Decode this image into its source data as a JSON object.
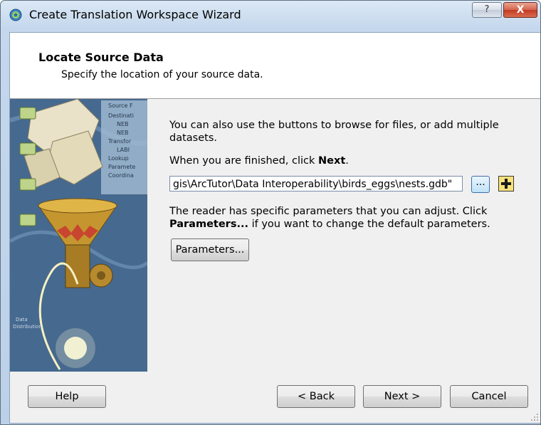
{
  "window": {
    "title": "Create Translation Workspace Wizard",
    "help_glyph": "?",
    "close_glyph": "X"
  },
  "header": {
    "title": "Locate Source Data",
    "subtitle": "Specify the location of your source data."
  },
  "sidebar": {
    "illustration_labels": [
      "Source F",
      "Destinati",
      "NEB",
      "NEB",
      "Transfor",
      "LABI",
      "Lookup",
      "Paramete",
      "Coordina"
    ]
  },
  "content": {
    "intro_line1": "You can also use the buttons to browse for files, or add multiple",
    "intro_line2": "datasets.",
    "finished_prefix": "When you are finished, click ",
    "finished_bold": "Next",
    "finished_suffix": ".",
    "source_path": "gis\\ArcTutor\\Data Interoperability\\birds_eggs\\nests.gdb\"",
    "browse_label": "...",
    "reader_line1": "The reader has specific parameters that you can adjust. Click",
    "reader_bold": "Parameters...",
    "reader_line2": " if you want to change the default parameters.",
    "parameters_button": "Parameters..."
  },
  "footer": {
    "help": "Help",
    "back": "< Back",
    "next": "Next >",
    "cancel": "Cancel"
  },
  "colors": {
    "title_bar": "#c4d7ec",
    "close_button": "#c23b24",
    "dialog_bg": "#f0f0f0",
    "sidebar": "#4c6e95",
    "add_button": "#f7e27a"
  },
  "icons": {
    "app": "fme-workbench-icon",
    "browse": "browse-ellipsis-icon",
    "add": "add-plus-icon",
    "grip": "resize-grip-icon"
  }
}
